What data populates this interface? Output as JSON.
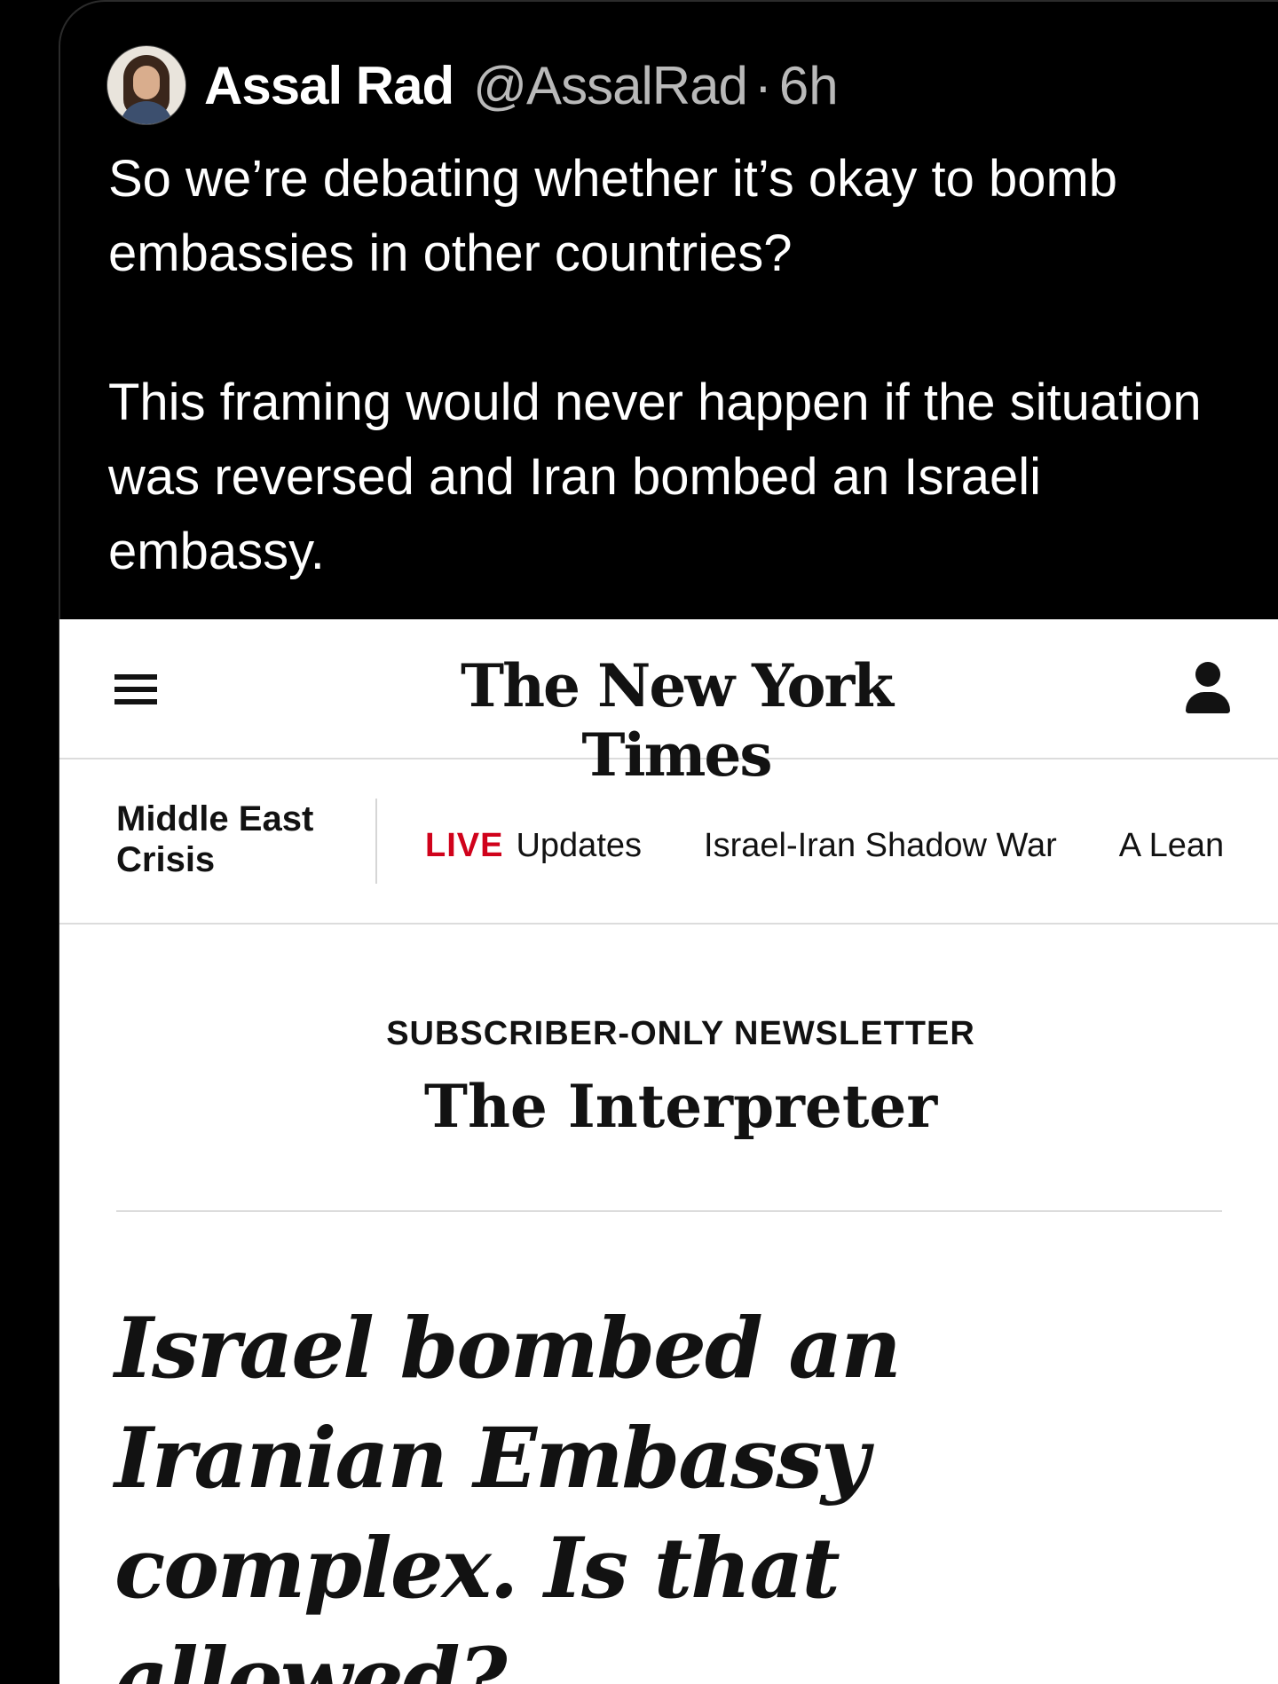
{
  "tweet": {
    "display_name": "Assal Rad",
    "handle": "@AssalRad",
    "separator": "·",
    "time": "6h",
    "paragraphs": [
      "So we’re debating whether it’s okay to bomb embassies in other countries?",
      "This framing would never happen if the situation was reversed and Iran bombed an Israeli embassy."
    ],
    "avatar_icon": "user-avatar"
  },
  "nyt": {
    "logo": "The New York Times",
    "menu_icon": "hamburger-menu-icon",
    "account_icon": "account-icon",
    "section": "Middle East Crisis",
    "nav": {
      "live_badge": "LIVE",
      "updates": "Updates",
      "shadow_war": "Israel-Iran Shadow War",
      "lean": "A Lean"
    },
    "newsletter_label": "SUBSCRIBER-ONLY NEWSLETTER",
    "newsletter_title": "The Interpreter",
    "headline": "Israel bombed an Iranian Embassy complex. Is that allowed?",
    "colors": {
      "live": "#d0021b",
      "text": "#121212"
    }
  }
}
